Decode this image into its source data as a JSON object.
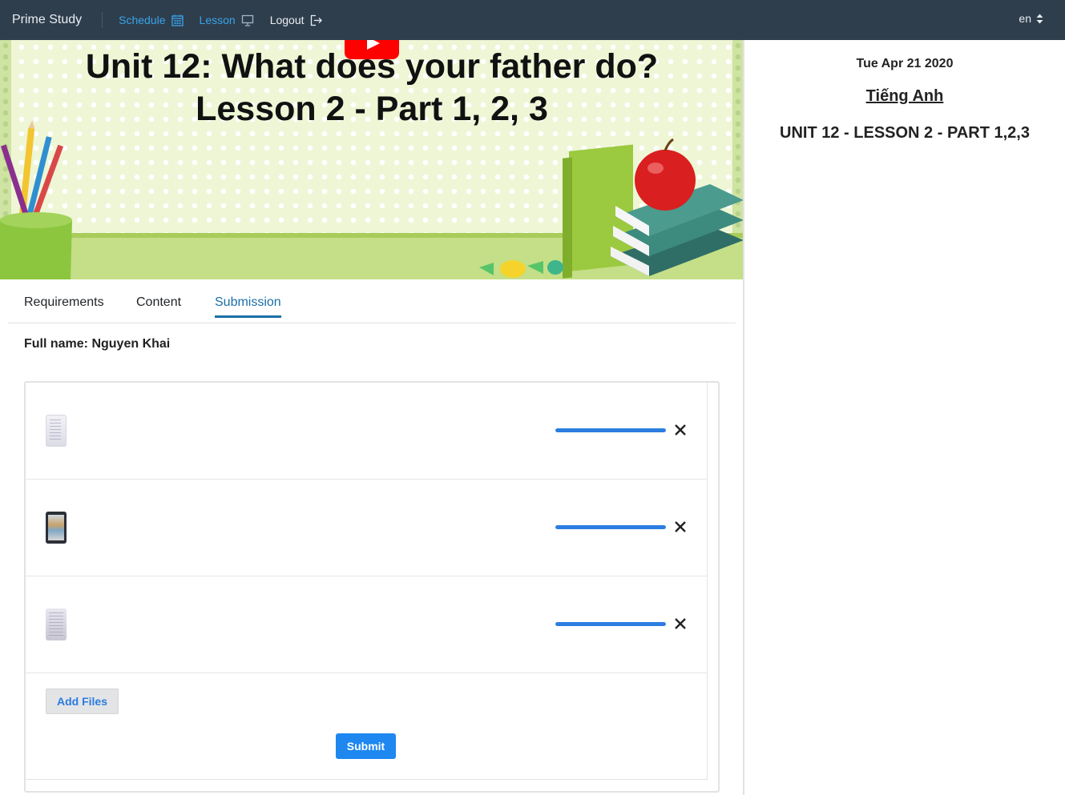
{
  "navbar": {
    "brand": "Prime Study",
    "schedule_label": "Schedule",
    "lesson_label": "Lesson",
    "logout_label": "Logout",
    "language": "en"
  },
  "banner": {
    "title_line1": "Unit 12: What does your father do?",
    "title_line2": "Lesson 2 - Part 1, 2, 3"
  },
  "tabs": [
    {
      "label": "Requirements",
      "active": false
    },
    {
      "label": "Content",
      "active": false
    },
    {
      "label": "Submission",
      "active": true
    }
  ],
  "submission": {
    "full_name": "Full name: Nguyen Khai",
    "files": [
      {
        "thumbnail": "document-scan",
        "progress": 1.0
      },
      {
        "thumbnail": "phone-photo",
        "progress": 1.0
      },
      {
        "thumbnail": "document-scan",
        "progress": 1.0
      }
    ],
    "add_files_label": "Add Files",
    "submit_label": "Submit"
  },
  "sidebar": {
    "date": "Tue Apr 21 2020",
    "subject": "Tiếng Anh",
    "lesson_title": "UNIT 12 - LESSON 2 - PART 1,2,3"
  },
  "colors": {
    "navbar_bg": "#2f3e4d",
    "nav_active": "#37a4ea",
    "tab_active": "#1b6fa8",
    "progress": "#2c7de0",
    "submit_bg": "#1e88f0"
  }
}
